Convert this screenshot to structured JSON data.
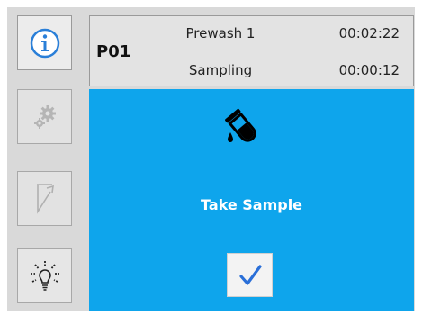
{
  "status": {
    "program": "P01",
    "steps": [
      {
        "name": "Prewash 1",
        "time": "00:02:22"
      },
      {
        "name": "Sampling",
        "time": "00:00:12"
      }
    ]
  },
  "main": {
    "icon": "test-tube-icon",
    "label": "Take Sample",
    "confirm_icon": "checkmark-icon",
    "background_color": "#0ea5ec"
  },
  "sidebar": {
    "items": [
      {
        "icon": "info-icon",
        "state": "active"
      },
      {
        "icon": "gear-icon",
        "state": "disabled"
      },
      {
        "icon": "funnel-icon",
        "state": "disabled"
      },
      {
        "icon": "light-bulb-icon",
        "state": "enabled"
      }
    ]
  },
  "colors": {
    "accent": "#0ea5ec",
    "info_icon": "#2a7fd8",
    "check": "#2a6fd8"
  }
}
